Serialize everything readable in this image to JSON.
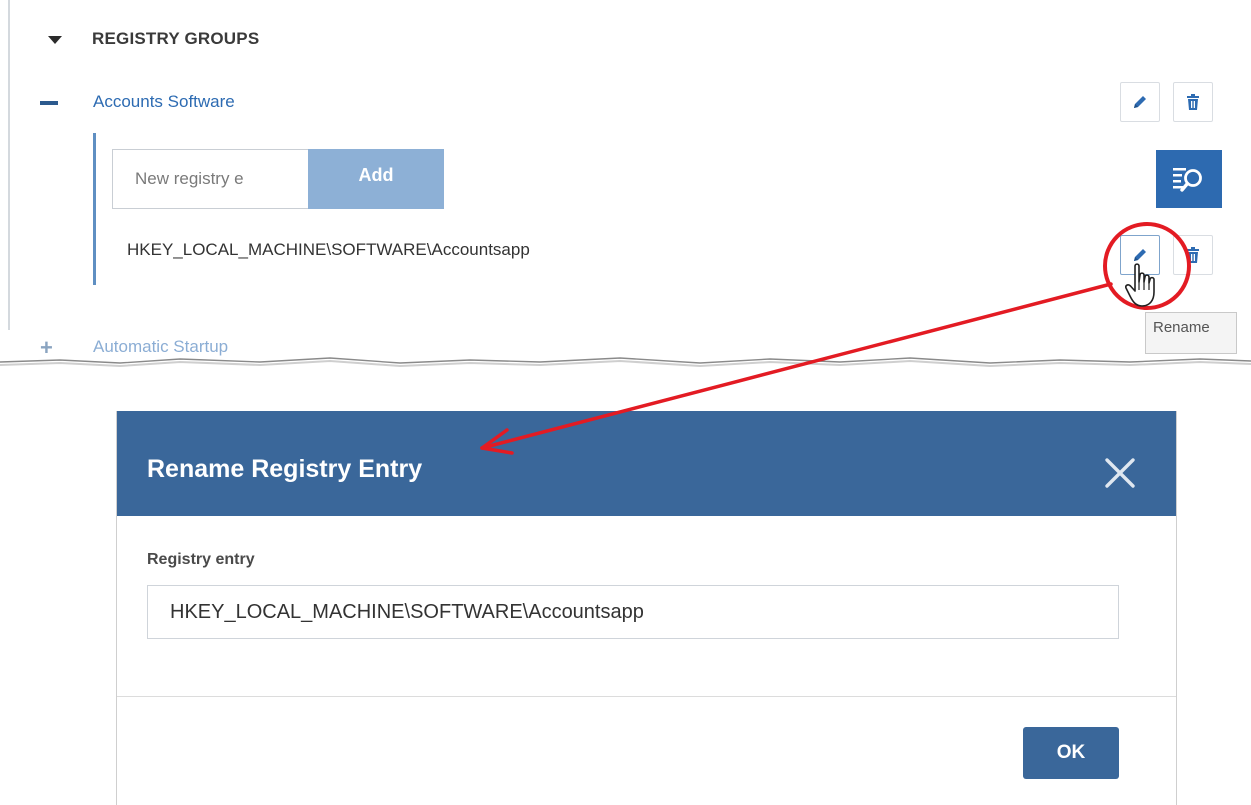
{
  "registry_groups": {
    "section_title": "REGISTRY GROUPS",
    "group": {
      "label": "Accounts Software",
      "new_entry_placeholder": "New registry e",
      "add_label": "Add",
      "entry_path": "HKEY_LOCAL_MACHINE\\SOFTWARE\\Accountsapp"
    },
    "next_group_label": "Automatic Startup",
    "tooltip_text": "Rename"
  },
  "dialog": {
    "title": "Rename Registry Entry",
    "field_label": "Registry entry",
    "field_value": "HKEY_LOCAL_MACHINE\\SOFTWARE\\Accountsapp",
    "ok_label": "OK"
  },
  "icons": {
    "section_toggle": "caret-down-icon",
    "group_collapse": "minus-icon",
    "group_expand": "plus-icon",
    "edit": "pencil-icon",
    "delete": "trash-icon",
    "browse": "search-list-icon",
    "close": "close-icon",
    "cursor": "hand-pointer-icon"
  },
  "colors": {
    "header_blue": "#3a679a",
    "link_blue": "#2d6bb2",
    "add_button": "#8db0d6",
    "search_button": "#2d6ab0",
    "annotation_red": "#e31b23"
  }
}
